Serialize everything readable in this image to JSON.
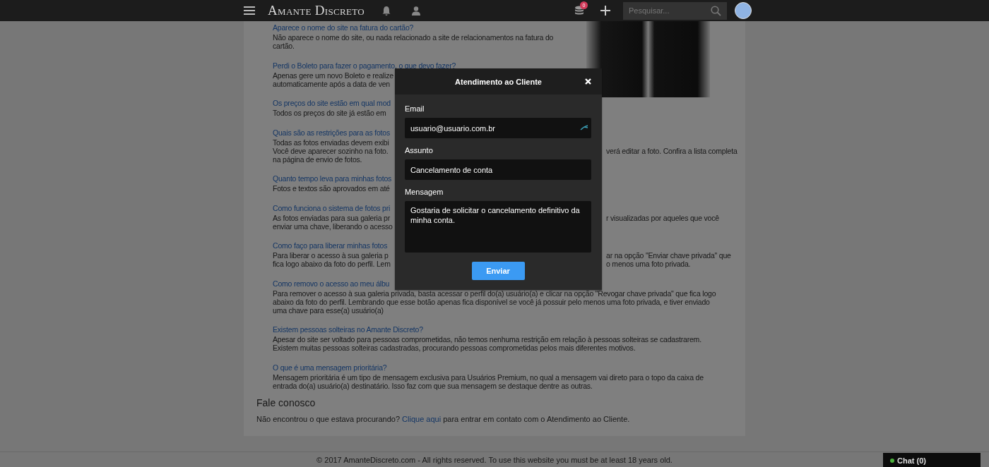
{
  "header": {
    "logo": "Amante Discreto",
    "coins_badge": "0",
    "search": {
      "placeholder": "Pesquisar..."
    }
  },
  "faq": [
    {
      "question": "Aparece o nome do site na fatura do cartão?",
      "answer_lines": [
        {
          "left": "Não aparece o nome do site, ou nada relacionado a site de relacionamentos na fatura do"
        },
        {
          "left": "cartão."
        }
      ]
    },
    {
      "question": "Perdi o Boleto para fazer o pagamento, o que devo fazer?",
      "answer_lines": [
        {
          "left": "Apenas gere um novo Boleto e realize"
        },
        {
          "left": "automaticamente após a data de ven"
        }
      ]
    },
    {
      "question": "Os preços do site estão em qual mod",
      "answer_lines": [
        {
          "left": "Todos os preços do site já estão em"
        }
      ]
    },
    {
      "question": "Quais são as restrições para as fotos",
      "answer_lines": [
        {
          "left": "Todas as fotos enviadas devem exibi"
        },
        {
          "left": "Você deve aparecer sozinho na foto.",
          "right": "verá editar a foto. Confira a lista completa"
        },
        {
          "left": "na página de envio de fotos."
        }
      ]
    },
    {
      "question": "Quanto tempo leva para minhas fotos",
      "answer_lines": [
        {
          "left": "Fotos e textos são aprovados em até"
        }
      ]
    },
    {
      "question": "Como funciona o sistema de fotos pri",
      "answer_lines": [
        {
          "left": "As fotos enviadas para sua galeria pr",
          "right": "r visualizadas por aqueles que você"
        },
        {
          "left": "enviar uma chave, liberando o acesso"
        }
      ]
    },
    {
      "question": "Como faço para liberar minhas fotos",
      "answer_lines": [
        {
          "left": "Para liberar o acesso à sua galeria p",
          "right": "ar na opção \"Enviar chave privada\" que"
        },
        {
          "left": "fica logo abaixo da foto do perfil. Lem",
          "right": "o menos uma foto privada."
        }
      ]
    },
    {
      "question": "Como removo o acesso ao meu álbu",
      "answer_lines": [
        {
          "left": "Para remover o acesso à sua galeria privada, basta acessar o perfil do(a) usuário(a) e clicar na opção \"Revogar chave privada\" que fica logo"
        },
        {
          "left": "abaixo da foto do perfil. Lembrando que esse botão apenas fica disponível se você já possuir pelo menos uma foto privada, e tiver enviado"
        },
        {
          "left": "uma chave para esse(a) usuário(a)"
        }
      ]
    },
    {
      "question": "Existem pessoas solteiras no Amante Discreto?",
      "answer_lines": [
        {
          "left": "Apesar do site ser voltado para pessoas comprometidas, não temos nenhuma restrição em relação à pessoas solteiras se cadastrarem."
        },
        {
          "left": "Existem muitas pessoas solteiras cadastradas, procurando pessoas comprometidas pelos mais diferentes motivos."
        }
      ]
    },
    {
      "question": "O que é uma mensagem prioritária?",
      "answer_lines": [
        {
          "left": "Mensagem prioritária é um tipo de mensagem exclusiva para Usuários Premium, no qual a mensagem vai direto para o topo da caixa de"
        },
        {
          "left": "entrada do(a) usuário(a) destinatário. Isso faz com que sua mensagem se destaque dentre as outras."
        }
      ]
    }
  ],
  "contact": {
    "title": "Fale conosco",
    "text_before": "Não encontrou o que estava procurando? ",
    "link": "Clique aqui",
    "text_after": " para entrar em contato com o Atendimento ao Cliente."
  },
  "footer": {
    "text": "© 2017 AmanteDiscreto.com - All rights reserved. To use this website you must be at least 18 years old."
  },
  "chat": {
    "label": "Chat (0)",
    "online": true
  },
  "modal": {
    "title": "Atendimento ao Cliente",
    "fields": [
      {
        "label": "Email",
        "kind": "input",
        "value": "usuario@usuario.com.br",
        "autofill_icon": true
      },
      {
        "label": "Assunto",
        "kind": "input",
        "value": "Cancelamento de conta",
        "autofill_icon": false
      },
      {
        "label": "Mensagem",
        "kind": "textarea",
        "value": "Gostaria de solicitar o cancelamento definitivo da minha conta.",
        "autofill_icon": false
      }
    ],
    "submit": "Enviar"
  }
}
